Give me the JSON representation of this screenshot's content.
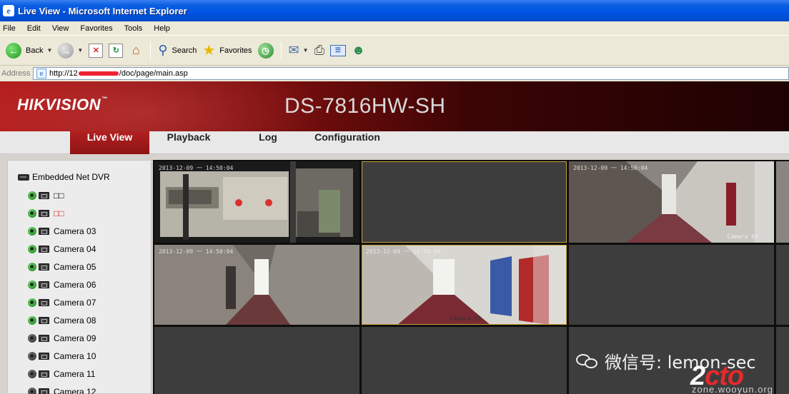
{
  "window": {
    "title": "Live View - Microsoft Internet Explorer",
    "ie_icon": "e"
  },
  "menu": {
    "items": [
      "File",
      "Edit",
      "View",
      "Favorites",
      "Tools",
      "Help"
    ]
  },
  "toolbar": {
    "back_label": "Back",
    "search_label": "Search",
    "favorites_label": "Favorites"
  },
  "address": {
    "label": "Address",
    "url_prefix": "http://12",
    "url_suffix": "/doc/page/main.asp"
  },
  "header": {
    "logo": "HIKVISION",
    "model": "DS-7816HW-SH"
  },
  "nav": {
    "tabs": [
      "Live View",
      "Playback",
      "Log",
      "Configuration"
    ],
    "active": "Live View"
  },
  "tree": {
    "root": "Embedded Net DVR",
    "cameras": [
      {
        "label": "□□",
        "recording": true,
        "highlight": false
      },
      {
        "label": "□□",
        "recording": true,
        "highlight": true
      },
      {
        "label": "Camera 03",
        "recording": true,
        "highlight": false
      },
      {
        "label": "Camera 04",
        "recording": true,
        "highlight": false
      },
      {
        "label": "Camera 05",
        "recording": true,
        "highlight": false
      },
      {
        "label": "Camera 06",
        "recording": true,
        "highlight": false
      },
      {
        "label": "Camera 07",
        "recording": true,
        "highlight": false
      },
      {
        "label": "Camera 08",
        "recording": true,
        "highlight": false
      },
      {
        "label": "Camera 09",
        "recording": false,
        "highlight": false
      },
      {
        "label": "Camera 10",
        "recording": false,
        "highlight": false
      },
      {
        "label": "Camera 11",
        "recording": false,
        "highlight": false
      },
      {
        "label": "Camera 12",
        "recording": false,
        "highlight": false
      }
    ]
  },
  "feeds": {
    "osd": "2013-12-09 一 14:50:04",
    "cam3_name": "Camera 03",
    "cam5_name": "Camera 05"
  },
  "watermark": {
    "wechat": "微信号: lemon-sec",
    "site_a": "2",
    "site_b": "cto",
    "site_c": "zone.wooyun.org"
  },
  "colors": {
    "brand_red": "#a81818",
    "title_blue": "#0a5fe0",
    "grid_bg": "#3d3d3d"
  }
}
